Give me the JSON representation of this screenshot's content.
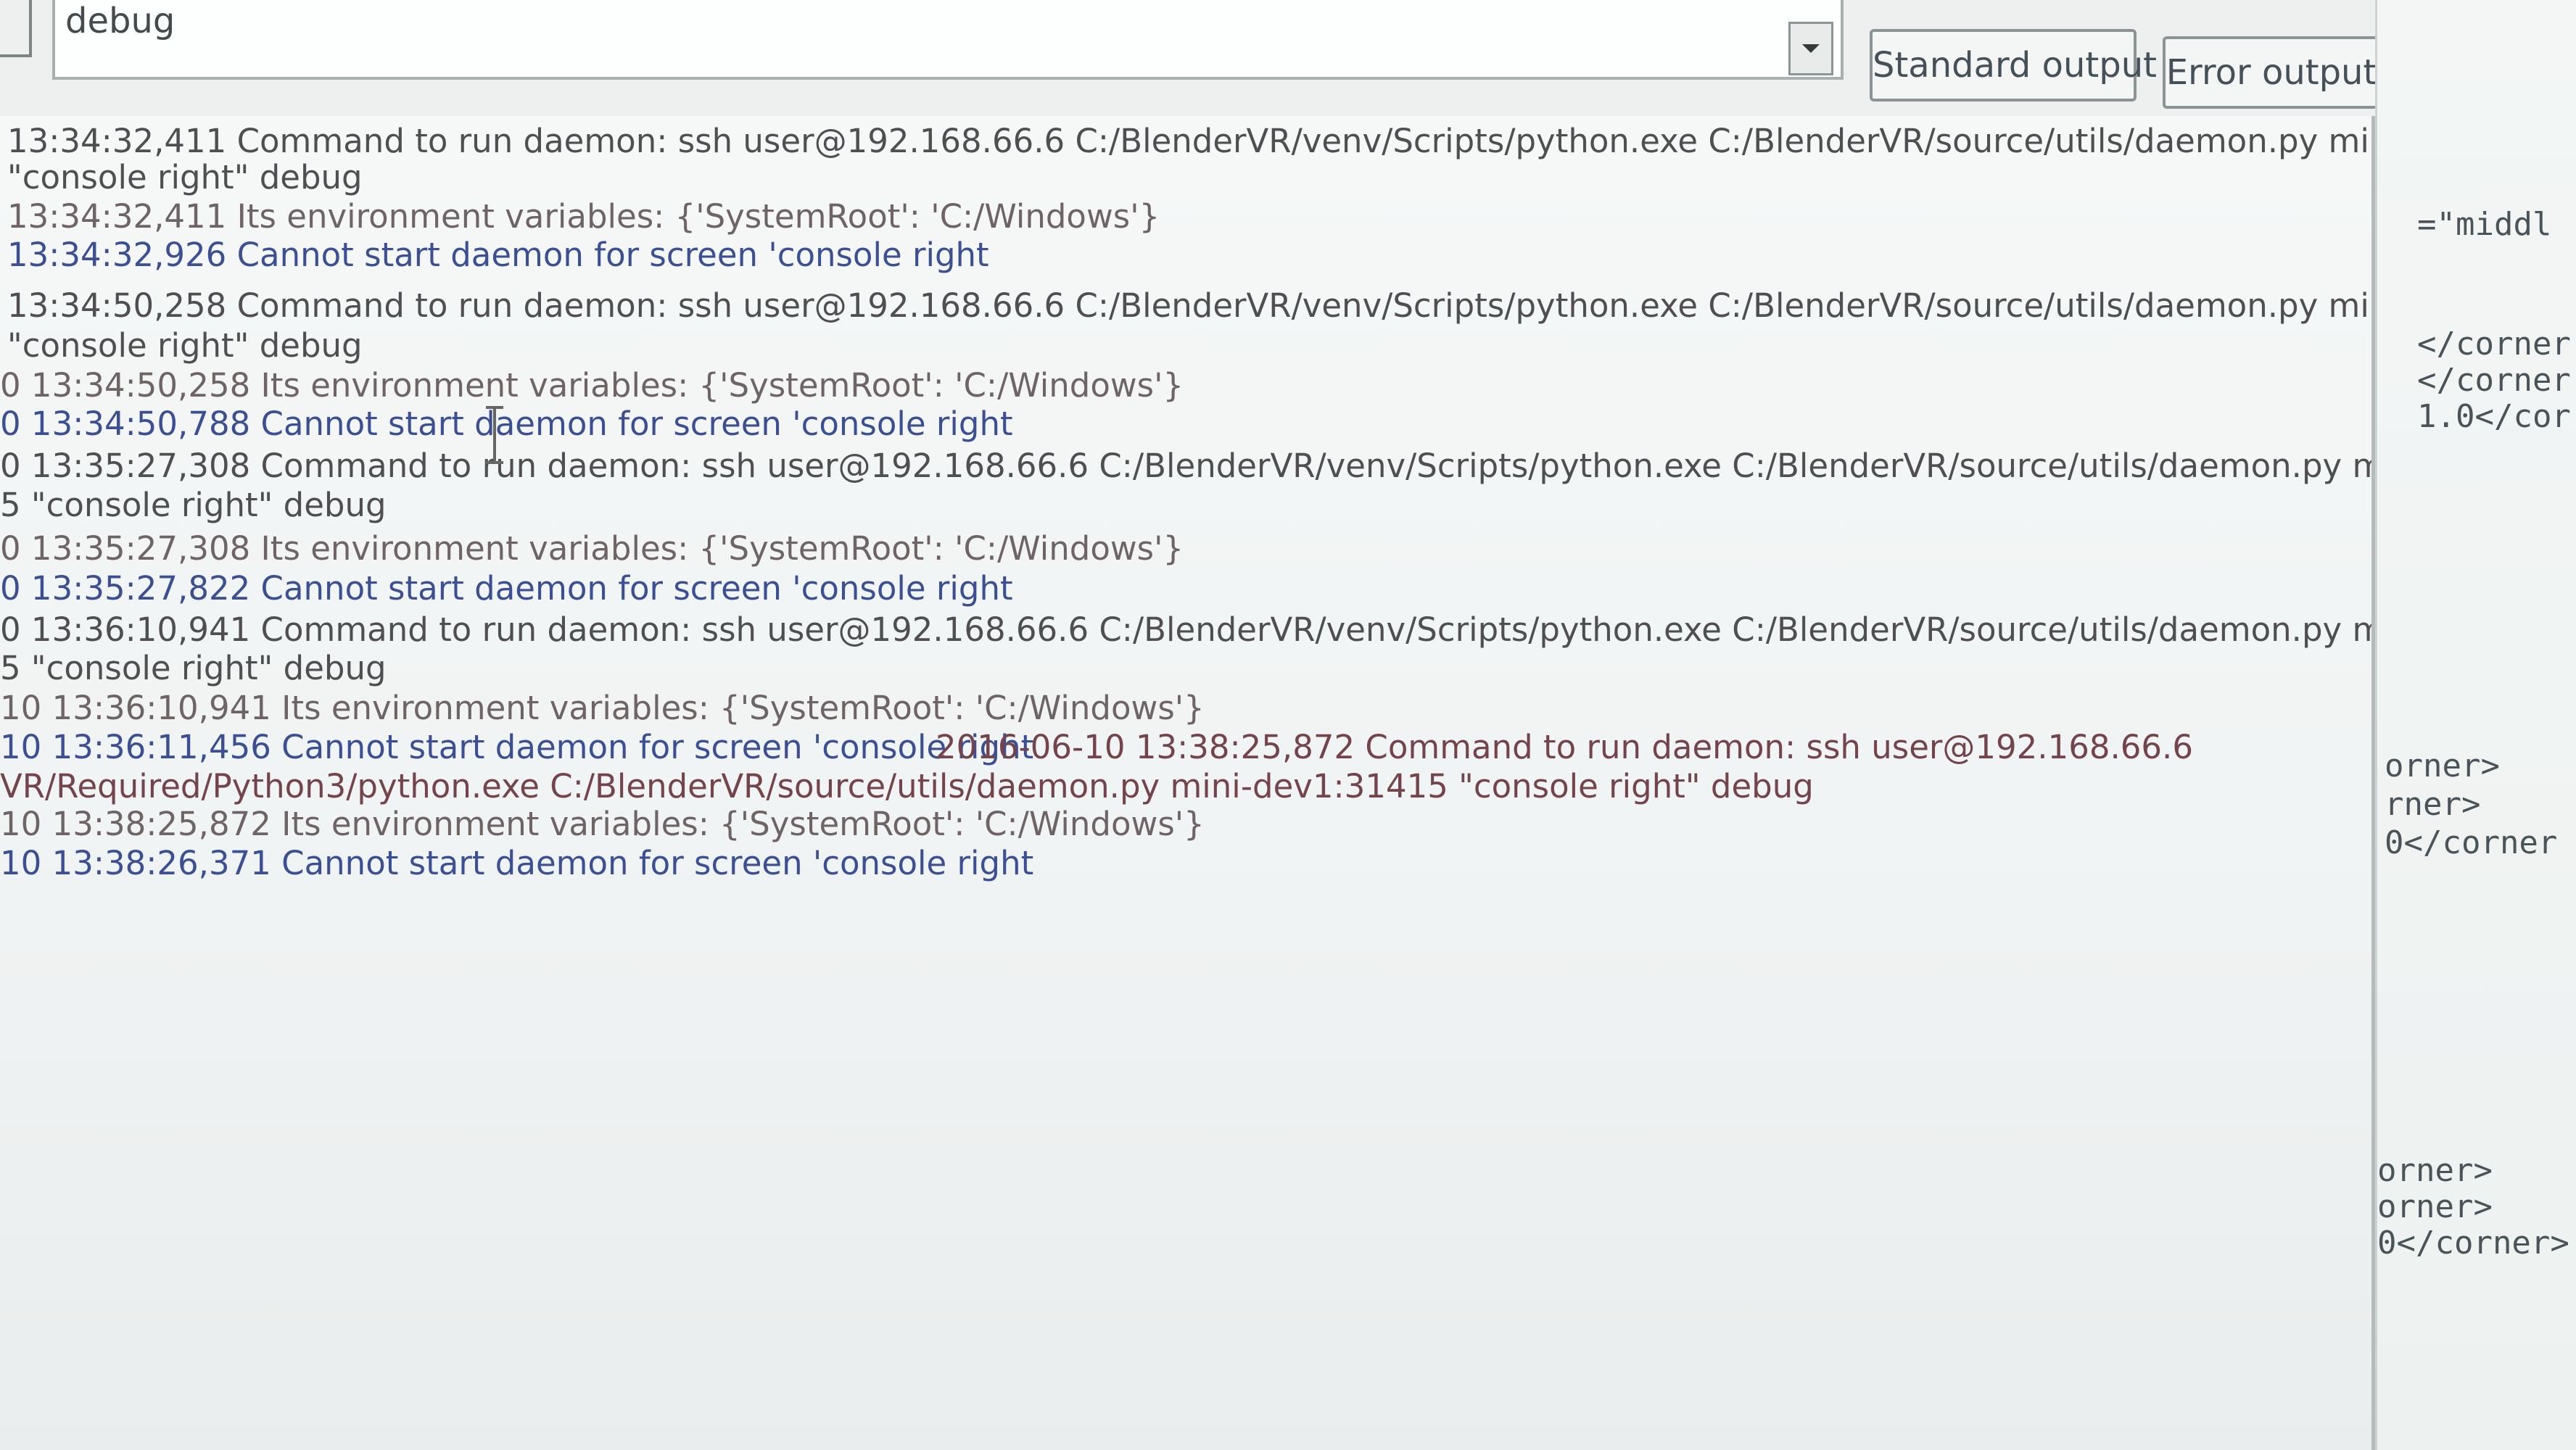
{
  "toolbar": {
    "level_value": "debug",
    "standard_output_label": "Standard output",
    "error_output_label": "Error output",
    "dropdown_icon": "chevron-down-icon"
  },
  "console": {
    "lines": [
      "13:34:32,411 Command to run daemon: ssh user@192.168.66.6 C:/BlenderVR/venv/Scripts/python.exe C:/BlenderVR/source/utils/daemon.py mini-",
      "\"console right\" debug",
      "13:34:32,411 Its environment variables: {'SystemRoot': 'C:/Windows'}",
      "13:34:32,926 Cannot start daemon for screen 'console right",
      "13:34:50,258 Command to run daemon: ssh user@192.168.66.6 C:/BlenderVR/venv/Scripts/python.exe C:/BlenderVR/source/utils/daemon.py mini-",
      "\"console right\" debug",
      "0 13:34:50,258 Its environment variables: {'SystemRoot': 'C:/Windows'}",
      "0 13:34:50,788 Cannot start daemon for screen 'console right",
      "0 13:35:27,308 Command to run daemon: ssh user@192.168.66.6 C:/BlenderVR/venv/Scripts/python.exe C:/BlenderVR/source/utils/daemon.py mini-",
      "5 \"console right\" debug",
      "0 13:35:27,308 Its environment variables: {'SystemRoot': 'C:/Windows'}",
      "0 13:35:27,822 Cannot start daemon for screen 'console right",
      "0 13:36:10,941 Command to run daemon: ssh user@192.168.66.6 C:/BlenderVR/venv/Scripts/python.exe C:/BlenderVR/source/utils/daemon.py mini-",
      "5 \"console right\" debug",
      "10 13:36:10,941 Its environment variables: {'SystemRoot': 'C:/Windows'}",
      "10 13:36:11,456 Cannot start daemon for screen 'console right",
      "2016-06-10 13:38:25,872 Command to run daemon: ssh user@192.168.66.6",
      "VR/Required/Python3/python.exe C:/BlenderVR/source/utils/daemon.py mini-dev1:31415 \"console right\" debug",
      "10 13:38:25,872 Its environment variables: {'SystemRoot': 'C:/Windows'}",
      "10 13:38:26,371 Cannot start daemon for screen 'console right"
    ]
  },
  "side_panel": {
    "lines": [
      "=\"middl",
      "</corner",
      "</corner",
      "1.0</cor",
      "orner>",
      "rner>",
      "0</corner",
      "orner>",
      "orner>",
      "0</corner>"
    ]
  }
}
